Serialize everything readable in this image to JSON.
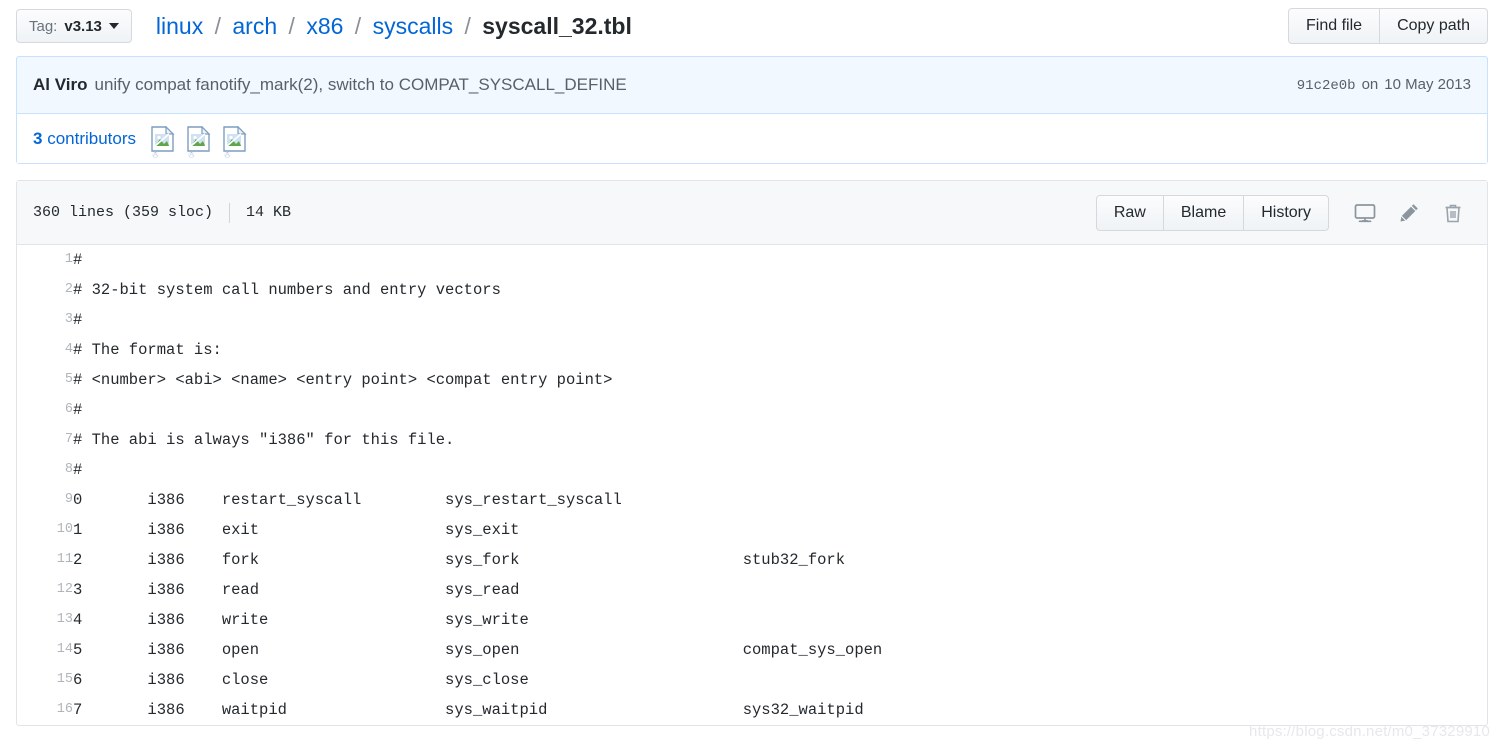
{
  "topbar": {
    "tag_label": "Tag:",
    "tag_value": "v3.13",
    "breadcrumb": [
      {
        "text": "linux",
        "link": true
      },
      {
        "text": "arch",
        "link": true
      },
      {
        "text": "x86",
        "link": true
      },
      {
        "text": "syscalls",
        "link": true
      },
      {
        "text": "syscall_32.tbl",
        "link": false
      }
    ],
    "separator": "/",
    "find_file_label": "Find file",
    "copy_path_label": "Copy path"
  },
  "commit": {
    "author": "Al Viro",
    "message": "unify compat fanotify_mark(2), switch to COMPAT_SYSCALL_DEFINE",
    "sha": "91c2e0b",
    "date_prefix": "on",
    "date": "10 May 2013",
    "contributors_count": "3",
    "contributors_label": "contributors",
    "avatars": [
      "broken-image-icon",
      "broken-image-icon",
      "broken-image-icon"
    ]
  },
  "file": {
    "lines_label": "360 lines (359 sloc)",
    "size_label": "14 KB",
    "raw_label": "Raw",
    "blame_label": "Blame",
    "history_label": "History",
    "icons": {
      "desktop": "desktop-icon",
      "edit": "pencil-icon",
      "delete": "trash-icon"
    }
  },
  "code": {
    "lines": [
      {
        "n": "1",
        "text": "#"
      },
      {
        "n": "2",
        "text": "# 32-bit system call numbers and entry vectors"
      },
      {
        "n": "3",
        "text": "#"
      },
      {
        "n": "4",
        "text": "# The format is:"
      },
      {
        "n": "5",
        "text": "# <number> <abi> <name> <entry point> <compat entry point>"
      },
      {
        "n": "6",
        "text": "#"
      },
      {
        "n": "7",
        "text": "# The abi is always \"i386\" for this file."
      },
      {
        "n": "8",
        "text": "#"
      },
      {
        "n": "9",
        "text": "0\ti386\trestart_syscall\t\tsys_restart_syscall"
      },
      {
        "n": "10",
        "text": "1\ti386\texit\t\t\tsys_exit"
      },
      {
        "n": "11",
        "text": "2\ti386\tfork\t\t\tsys_fork\t\t\tstub32_fork"
      },
      {
        "n": "12",
        "text": "3\ti386\tread\t\t\tsys_read"
      },
      {
        "n": "13",
        "text": "4\ti386\twrite\t\t\tsys_write"
      },
      {
        "n": "14",
        "text": "5\ti386\topen\t\t\tsys_open\t\t\tcompat_sys_open"
      },
      {
        "n": "15",
        "text": "6\ti386\tclose\t\t\tsys_close"
      },
      {
        "n": "16",
        "text": "7\ti386\twaitpid\t\t\tsys_waitpid\t\t\tsys32_waitpid"
      }
    ]
  },
  "watermark": {
    "text": "https://blog.csdn.net/m0_37329910"
  },
  "colors": {
    "link_blue": "#0366d6",
    "commit_bg": "#f1f8ff",
    "commit_border": "#c8e1ff",
    "header_bg": "#f6f8fa",
    "box_border": "#e1e4e8"
  }
}
